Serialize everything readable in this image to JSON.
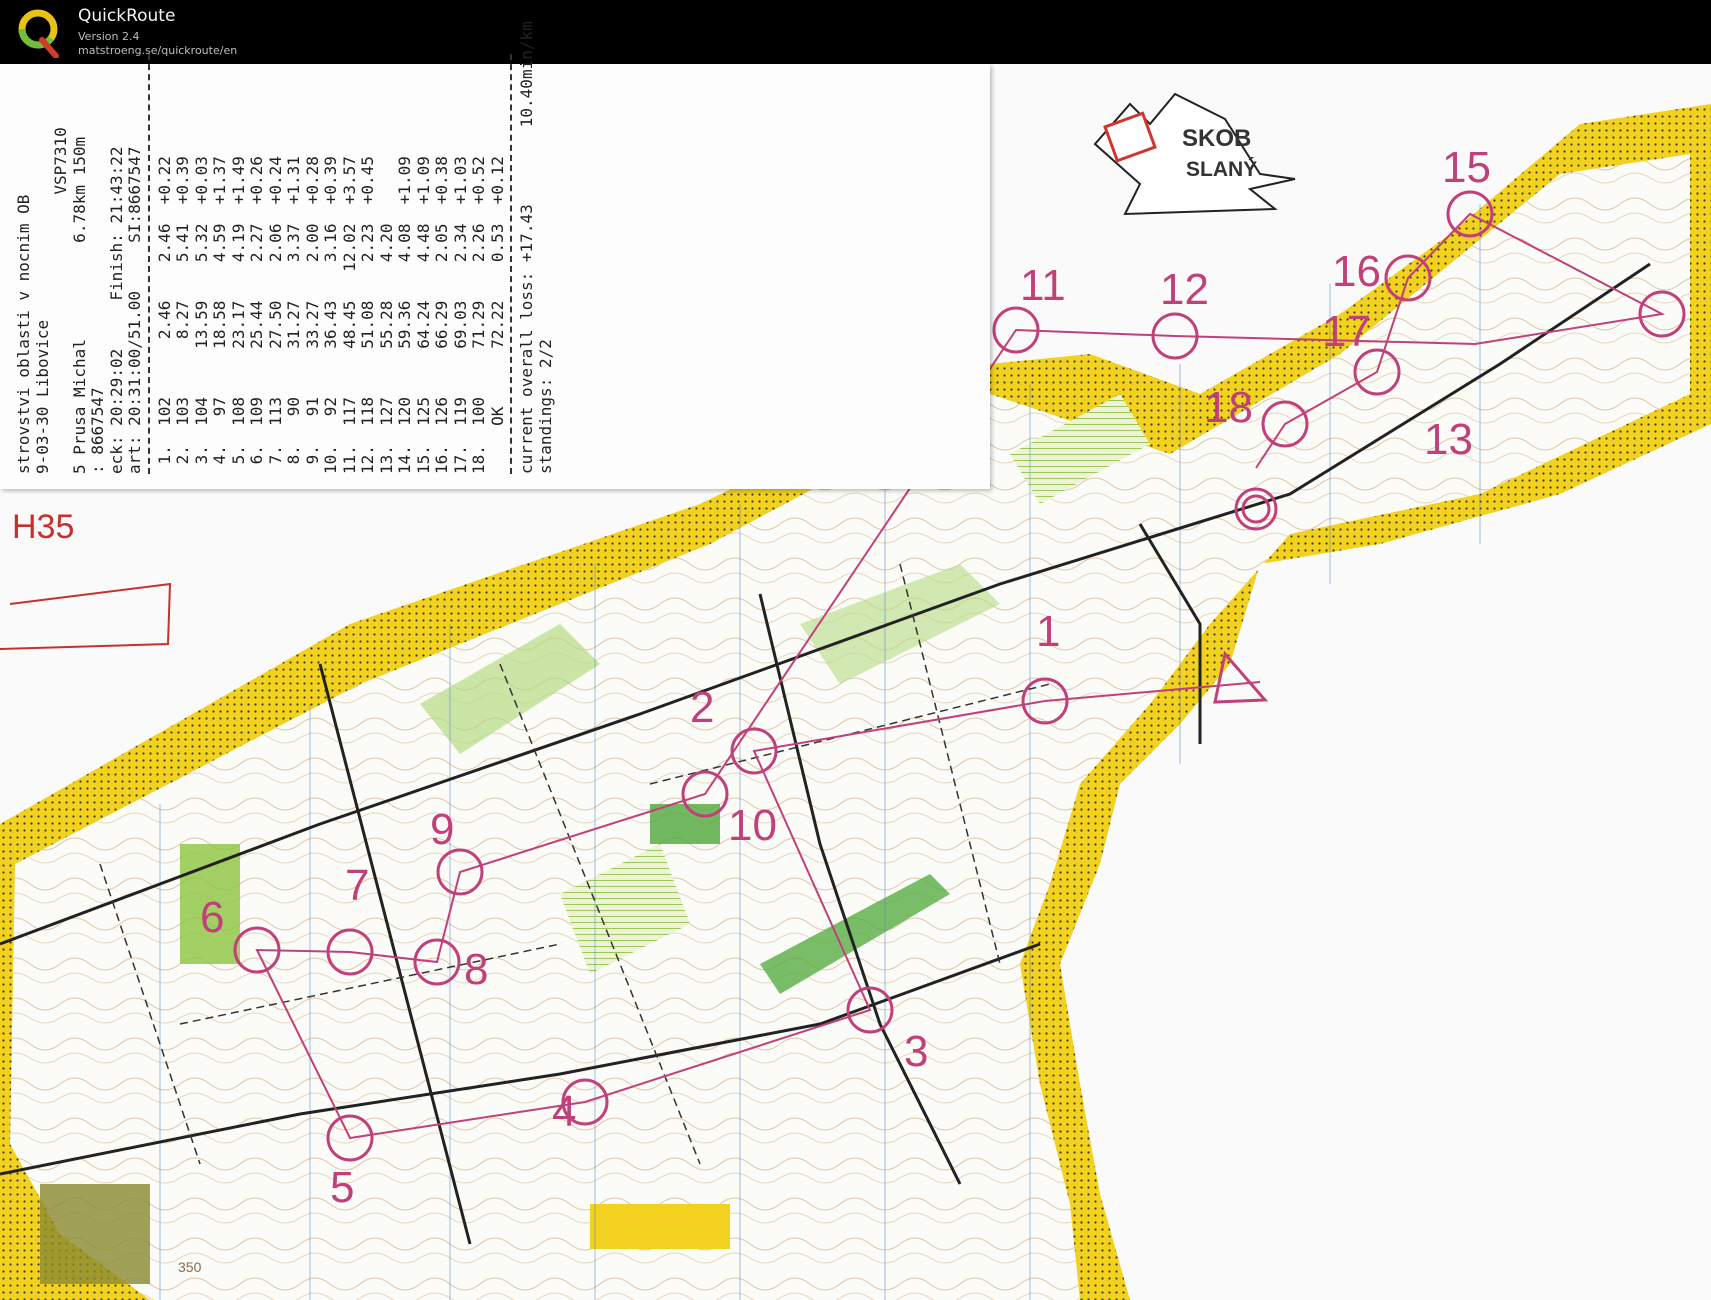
{
  "app": {
    "title": "QuickRoute",
    "version": "Version 2.4",
    "url": "matstroeng.se/quickroute/en"
  },
  "map": {
    "club_logo_line1": "SKOB",
    "club_logo_line2": "SLANÝ",
    "category": "H35",
    "elevation_label": "350",
    "controls": [
      "1",
      "2",
      "3",
      "4",
      "5",
      "6",
      "7",
      "8",
      "9",
      "10",
      "11",
      "12",
      "13",
      "15",
      "16",
      "17",
      "18"
    ]
  },
  "receipt": {
    "lines": [
      "strovstvi oblasti v nocnim OB",
      "9-03-30 Libovice",
      "                             VSP7310",
      "5 Prusa Michal          6.78km 150m",
      ": 8667547",
      "eck: 20:29:02     Finish: 21:43:22",
      "art: 20:31:00/51.00     SI:8667547"
    ],
    "splits": [
      " 1.  102      2.46    2.46  +0.22",
      " 2.  103      8.27    5.41  +0.39",
      " 3.  104     13.59    5.32  +0.03",
      " 4.   97     18.58    4.59  +1.37",
      " 5.  108     23.17    4.19  +1.49",
      " 6.  109     25.44    2.27  +0.26",
      " 7.  113     27.50    2.06  +0.24",
      " 8.   90     31.27    3.37  +1.31",
      " 9.   91     33.27    2.00  +0.28",
      "10.   92     36.43    3.16  +0.39",
      "11.  117     48.45   12.02  +3.57",
      "12.  118     51.08    2.23  +0.45",
      "13.  127     55.28    4.20",
      "14.  120     59.36    4.08  +1.09",
      "15.  125     64.24    4.48  +1.09",
      "16.  126     66.29    2.05  +0.38",
      "17.  119     69.03    2.34  +1.03",
      "18.  100     71.29    2.26  +0.52",
      "     OK      72.22    0.53  +0.12"
    ],
    "footer": [
      "current overall loss: +17.43        10.40min/km",
      "standings: 2/2"
    ]
  },
  "colors": {
    "course": "#c2407a",
    "open_land": "#f2d21e",
    "forest_green": "#8cc63f",
    "titlebar": "#000000"
  }
}
